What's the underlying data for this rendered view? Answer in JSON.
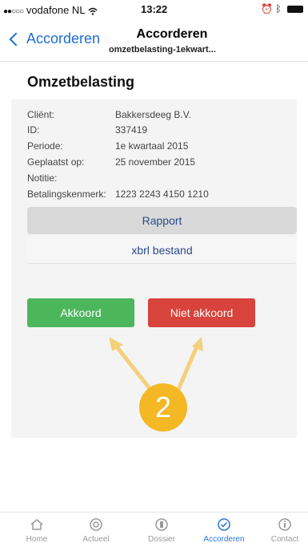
{
  "status_bar": {
    "carrier": "vodafone NL",
    "time": "13:22"
  },
  "nav": {
    "back_label": "Accorderen",
    "title": "Accorderen",
    "subtitle": "omzetbelasting-1ekwart..."
  },
  "heading": "Omzetbelasting",
  "details": [
    {
      "label": "Cliënt:",
      "value": "Bakkersdeeg B.V."
    },
    {
      "label": "ID:",
      "value": "337419"
    },
    {
      "label": "Periode:",
      "value": "1e kwartaal 2015"
    },
    {
      "label": "Geplaatst op:",
      "value": "25 november 2015"
    },
    {
      "label": "Notitie:",
      "value": ""
    },
    {
      "label": "Betalingskenmerk:",
      "value": "1223 2243 4150 1210"
    }
  ],
  "buttons": {
    "rapport": "Rapport",
    "xbrl": "xbrl bestand",
    "akkoord": "Akkoord",
    "niet_akkoord": "Niet akkoord"
  },
  "annotation": {
    "badge": "2"
  },
  "tabs": [
    {
      "label": "Home",
      "icon": "home-icon"
    },
    {
      "label": "Actueel",
      "icon": "actueel-icon"
    },
    {
      "label": "Dossier",
      "icon": "dossier-icon"
    },
    {
      "label": "Accorderen",
      "icon": "check-circle-icon",
      "active": true
    },
    {
      "label": "Contact",
      "icon": "info-icon"
    }
  ],
  "colors": {
    "accent": "#2a78d5",
    "akkoord": "#4cb65d",
    "niet_akkoord": "#d8433b",
    "badge": "#f3b824"
  }
}
